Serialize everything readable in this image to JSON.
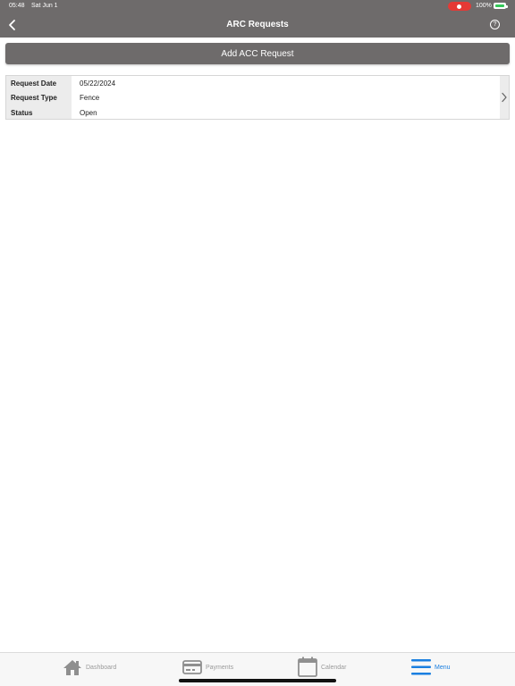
{
  "status_bar": {
    "time": "05:48",
    "date": "Sat Jun 1",
    "battery": "100%"
  },
  "header": {
    "title": "ARC Requests",
    "back_icon": "chevron-left-icon",
    "help_icon": "question-circle-icon",
    "help_glyph": "?"
  },
  "actions": {
    "add_label": "Add ACC Request"
  },
  "requests": [
    {
      "date_label": "Request Date",
      "date_value": "05/22/2024",
      "type_label": "Request Type",
      "type_value": "Fence",
      "status_label": "Status",
      "status_value": "Open"
    }
  ],
  "tabs": [
    {
      "label": "Dashboard",
      "icon": "home-icon",
      "active": false
    },
    {
      "label": "Payments",
      "icon": "card-icon",
      "active": false
    },
    {
      "label": "Calendar",
      "icon": "calendar-icon",
      "active": false
    },
    {
      "label": "Menu",
      "icon": "hamburger-icon",
      "active": true
    }
  ],
  "colors": {
    "header_bg": "#6e6b6b",
    "active_tab": "#1a7fe0",
    "inactive_tab": "#9a9a9a",
    "label_bg": "#ececec"
  }
}
